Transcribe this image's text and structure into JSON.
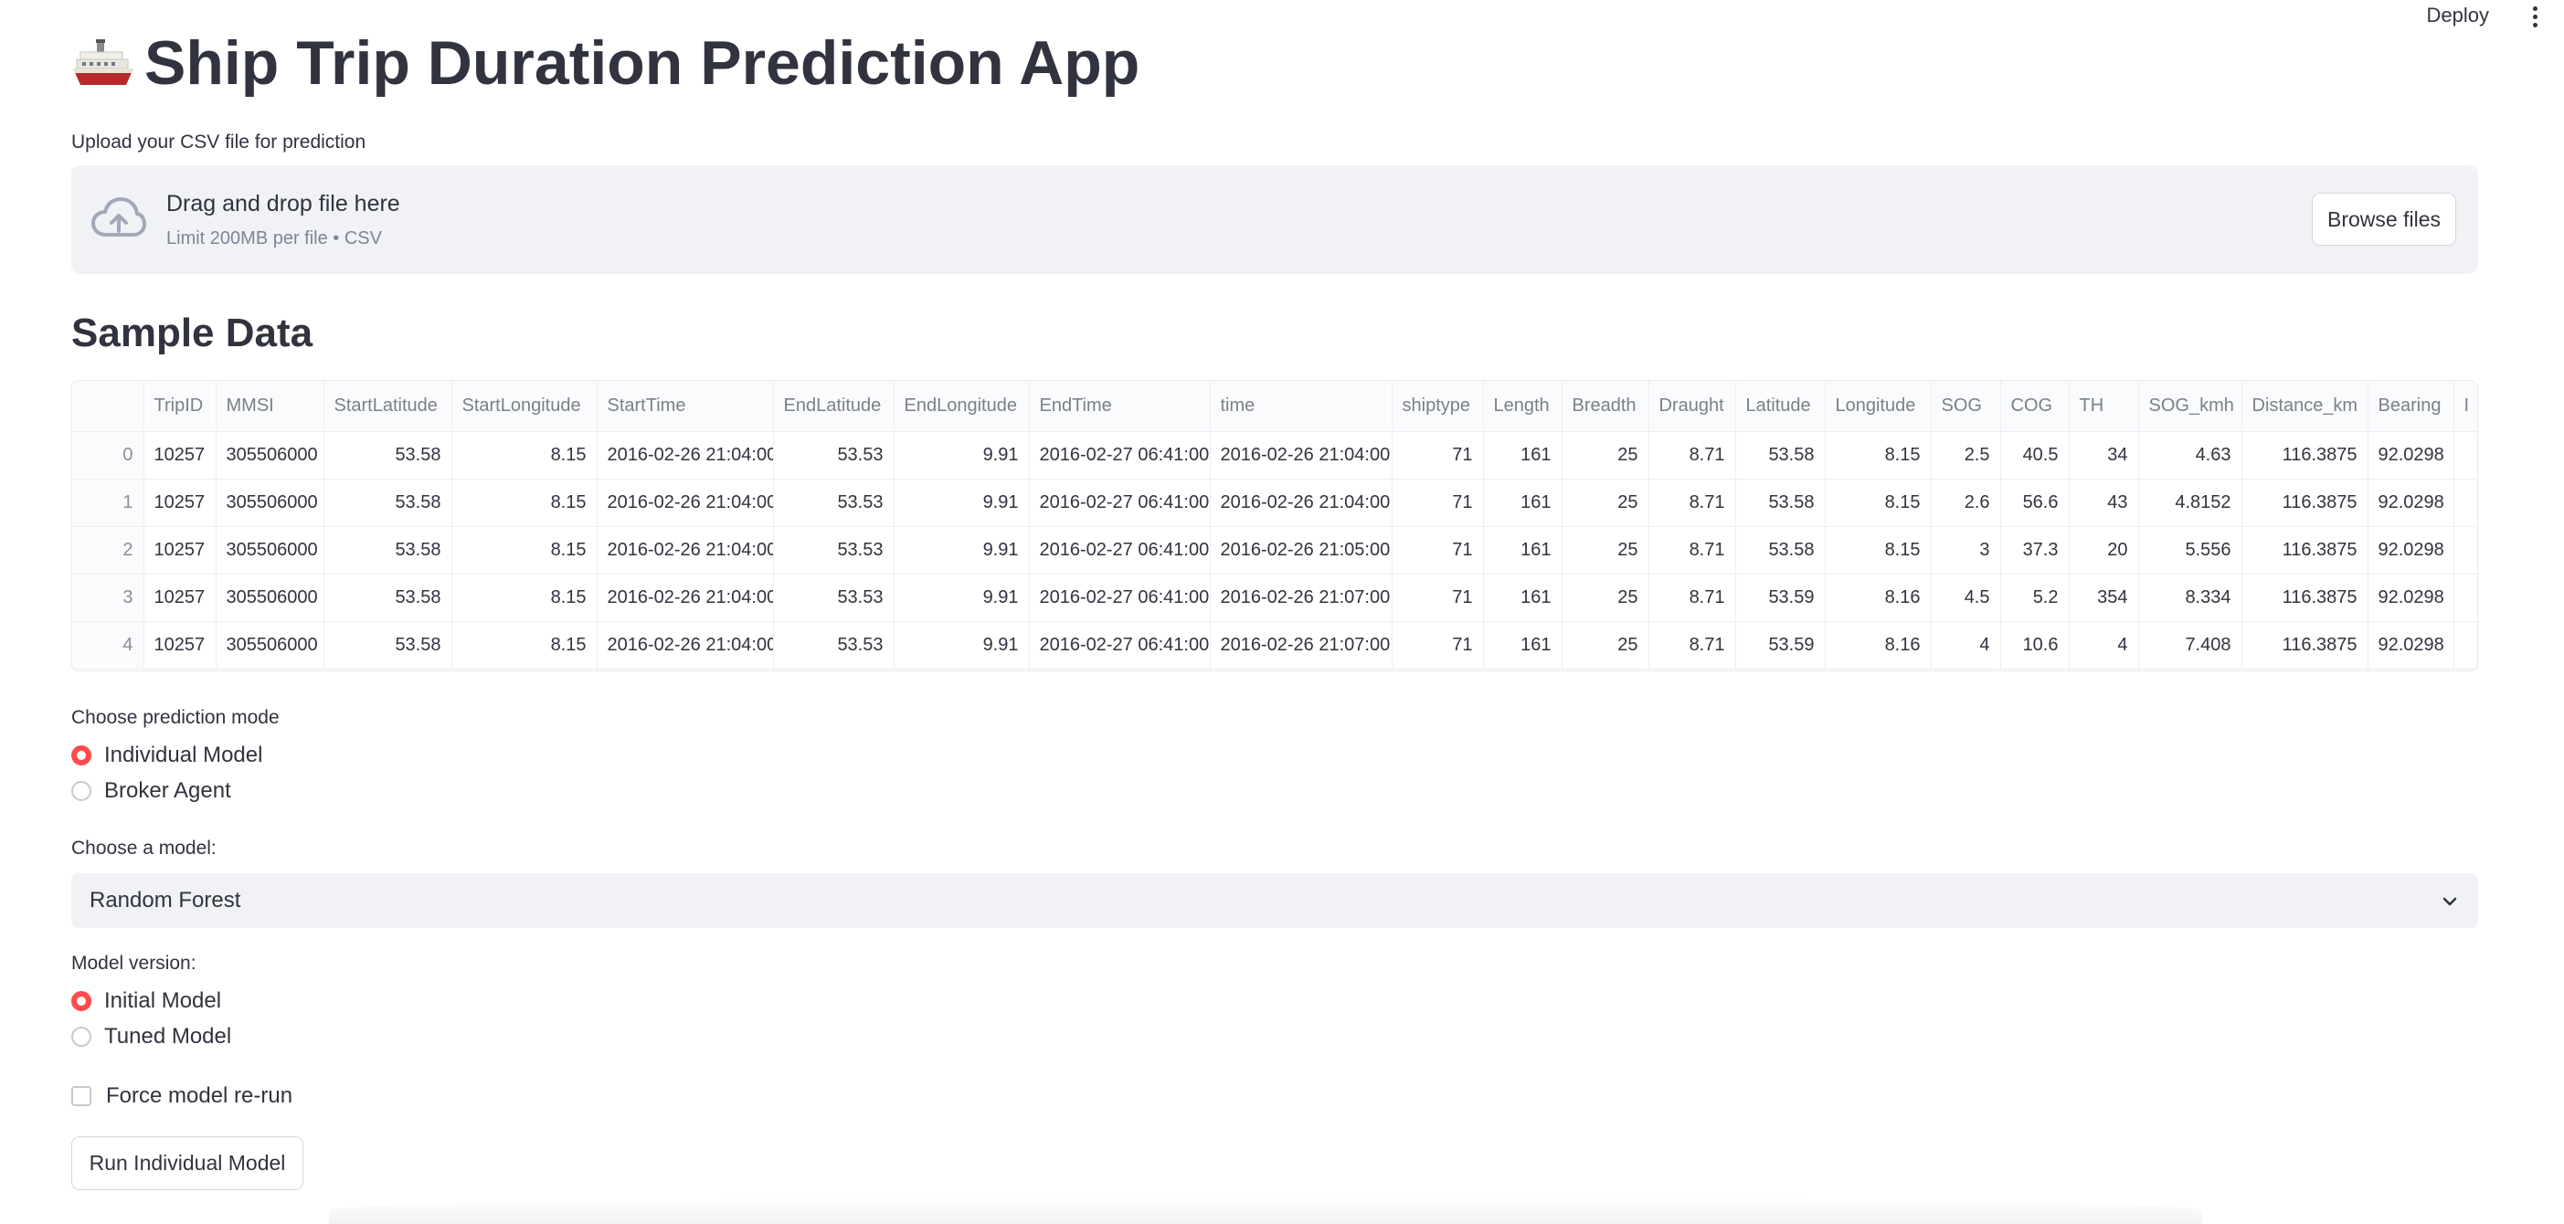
{
  "header": {
    "deploy_label": "Deploy",
    "menu_icon": "kebab-menu-icon"
  },
  "title": {
    "icon": "ship-emoji-icon",
    "text": "Ship Trip Duration Prediction App"
  },
  "uploader": {
    "label": "Upload your CSV file for prediction",
    "icon": "cloud-upload-icon",
    "drop_text": "Drag and drop file here",
    "limit_text": "Limit 200MB per file • CSV",
    "browse_label": "Browse files"
  },
  "sample": {
    "heading": "Sample Data",
    "columns": [
      "TripID",
      "MMSI",
      "StartLatitude",
      "StartLongitude",
      "StartTime",
      "EndLatitude",
      "EndLongitude",
      "EndTime",
      "time",
      "shiptype",
      "Length",
      "Breadth",
      "Draught",
      "Latitude",
      "Longitude",
      "SOG",
      "COG",
      "TH",
      "SOG_kmh",
      "Distance_km",
      "Bearing",
      "I"
    ],
    "rows": [
      {
        "index": "0",
        "cells": [
          "10257",
          "305506000",
          "53.58",
          "8.15",
          "2016-02-26 21:04:00",
          "53.53",
          "9.91",
          "2016-02-27 06:41:00",
          "2016-02-26 21:04:00",
          "71",
          "161",
          "25",
          "8.71",
          "53.58",
          "8.15",
          "2.5",
          "40.5",
          "34",
          "4.63",
          "116.3875",
          "92.0298",
          ""
        ]
      },
      {
        "index": "1",
        "cells": [
          "10257",
          "305506000",
          "53.58",
          "8.15",
          "2016-02-26 21:04:00",
          "53.53",
          "9.91",
          "2016-02-27 06:41:00",
          "2016-02-26 21:04:00",
          "71",
          "161",
          "25",
          "8.71",
          "53.58",
          "8.15",
          "2.6",
          "56.6",
          "43",
          "4.8152",
          "116.3875",
          "92.0298",
          ""
        ]
      },
      {
        "index": "2",
        "cells": [
          "10257",
          "305506000",
          "53.58",
          "8.15",
          "2016-02-26 21:04:00",
          "53.53",
          "9.91",
          "2016-02-27 06:41:00",
          "2016-02-26 21:05:00",
          "71",
          "161",
          "25",
          "8.71",
          "53.58",
          "8.15",
          "3",
          "37.3",
          "20",
          "5.556",
          "116.3875",
          "92.0298",
          ""
        ]
      },
      {
        "index": "3",
        "cells": [
          "10257",
          "305506000",
          "53.58",
          "8.15",
          "2016-02-26 21:04:00",
          "53.53",
          "9.91",
          "2016-02-27 06:41:00",
          "2016-02-26 21:07:00",
          "71",
          "161",
          "25",
          "8.71",
          "53.59",
          "8.16",
          "4.5",
          "5.2",
          "354",
          "8.334",
          "116.3875",
          "92.0298",
          ""
        ]
      },
      {
        "index": "4",
        "cells": [
          "10257",
          "305506000",
          "53.58",
          "8.15",
          "2016-02-26 21:04:00",
          "53.53",
          "9.91",
          "2016-02-27 06:41:00",
          "2016-02-26 21:07:00",
          "71",
          "161",
          "25",
          "8.71",
          "53.59",
          "8.16",
          "4",
          "10.6",
          "4",
          "7.408",
          "116.3875",
          "92.0298",
          ""
        ]
      }
    ]
  },
  "prediction_mode": {
    "label": "Choose prediction mode",
    "options": [
      "Individual Model",
      "Broker Agent"
    ],
    "selected": 0
  },
  "model_select": {
    "label": "Choose a model:",
    "value": "Random Forest",
    "icon": "chevron-down-icon"
  },
  "model_version": {
    "label": "Model version:",
    "options": [
      "Initial Model",
      "Tuned Model"
    ],
    "selected": 0
  },
  "force_rerun": {
    "label": "Force model re-run",
    "checked": false
  },
  "run_button": {
    "label": "Run Individual Model"
  },
  "colors": {
    "accent": "#ff4b4b",
    "text": "#31333f",
    "muted": "#808495",
    "panel": "#f0f2f6"
  }
}
